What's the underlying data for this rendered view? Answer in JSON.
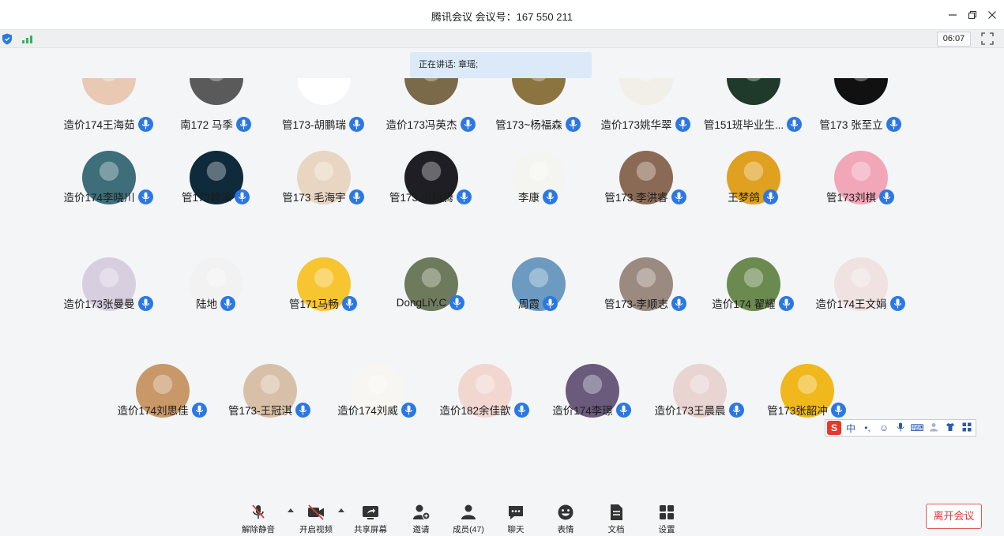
{
  "window": {
    "title": "腾讯会议 会议号：167 550 211"
  },
  "infobar": {
    "timer": "06:07"
  },
  "speaking": {
    "text": "正在讲话: 章瑶;"
  },
  "participants": [
    [
      "造价174王海茹",
      "南172 马季",
      "管173-胡鹏瑞",
      "造价173冯英杰",
      "管173~杨福森",
      "造价173姚华翠",
      "管151班毕业生...",
      "管173 张至立"
    ],
    [
      "造价174李晓川",
      "管173魏涞",
      "管173 毛海宇",
      "管173-申腾腾",
      "李康",
      "管173 李洪睿",
      "王梦鸽",
      "管173刘棋"
    ],
    [
      "造价173张曼曼",
      "陆地",
      "管171马畅",
      "DongLiY.C",
      "周霞",
      "管173-李顺志",
      "造价174  翟耀",
      "造价174王文娟"
    ],
    [
      "造价174刘思佳",
      "管173-王冠淇",
      "造价174刘威",
      "造价182余佳歆",
      "造价174李璟",
      "造价173王晨晨",
      "管173张韶冲"
    ]
  ],
  "avatar_colors": [
    [
      "#e9c9b4",
      "#5a5a5a",
      "#ffffff",
      "#7b6a4a",
      "#8c7440",
      "#f2eee8",
      "#1f3a2a",
      "#111111"
    ],
    [
      "#3d6e7a",
      "#0f2a3a",
      "#e8d6c2",
      "#1e1e24",
      "#f4f4f0",
      "#8a6a55",
      "#e0a020",
      "#f2a7b8"
    ],
    [
      "#d7cfe0",
      "#f2f2f2",
      "#f6c530",
      "#6e7a5c",
      "#6c9ac0",
      "#9a8a80",
      "#6a8a50",
      "#efe2e0"
    ],
    [
      "#c89868",
      "#d8c0a8",
      "#f8f6f2",
      "#f1d7d0",
      "#6a5a7c",
      "#e8d4d0",
      "#f0b81c"
    ]
  ],
  "ime": {
    "logo": "S",
    "mode": "中",
    "punct": "•,",
    "emoji": "☺",
    "voice": "mic",
    "keyboard": "⌨",
    "user": "👤",
    "skin": "👕",
    "grid": "▦"
  },
  "toolbar": {
    "mute": "解除静音",
    "video": "开启视频",
    "share": "共享屏幕",
    "invite": "邀请",
    "members": "成员(47)",
    "chat": "聊天",
    "emoji": "表情",
    "docs": "文档",
    "settings": "设置",
    "leave": "离开会议"
  },
  "colors": {
    "accent": "#2b78e4",
    "signal": "#2fb35a",
    "leave": "#e0373a",
    "banner": "#dbe9f9"
  }
}
